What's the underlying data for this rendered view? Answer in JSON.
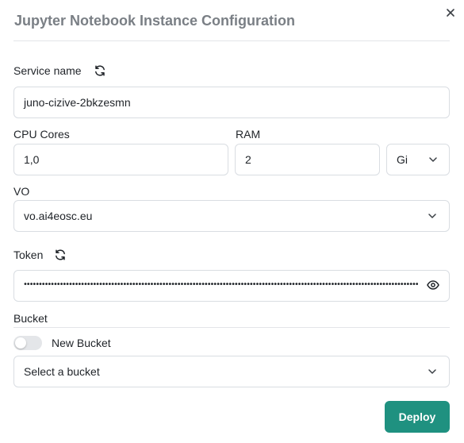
{
  "dialog": {
    "title": "Jupyter Notebook Instance Configuration"
  },
  "service_name": {
    "label": "Service name",
    "value": "juno-cizive-2bkzesmn"
  },
  "cpu": {
    "label": "CPU Cores",
    "value": "1,0"
  },
  "ram": {
    "label": "RAM",
    "value": "2",
    "unit": "Gi"
  },
  "vo": {
    "label": "VO",
    "value": "vo.ai4eosc.eu"
  },
  "token": {
    "label": "Token",
    "masked_value": "••••••••••••••••••••••••••••••••••••••••••••••••••••••••••••••••••••••••••••••••••••••••••••••••••••••••••••••••••••••••••••••••••••••••••••••••••••••••••••••••••••••••••••••••••••••••••••••••••••••••"
  },
  "bucket": {
    "label": "Bucket",
    "new_bucket_label": "New Bucket",
    "new_bucket_enabled": false,
    "select_placeholder": "Select a bucket"
  },
  "actions": {
    "deploy_label": "Deploy"
  },
  "colors": {
    "accent": "#1f9180",
    "title": "#7a7f85",
    "border": "#d9dde2"
  }
}
